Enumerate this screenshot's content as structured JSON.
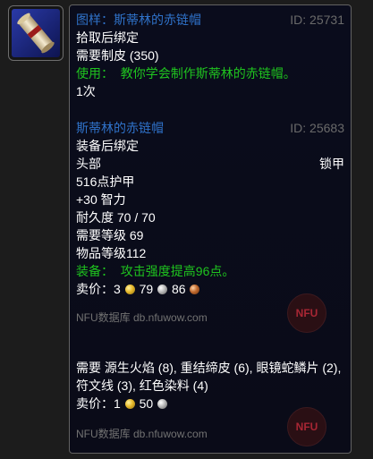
{
  "item_icon": "pattern-scroll-icon",
  "pattern": {
    "name": "图样：斯蒂林的赤链帽",
    "id": "ID: 25731",
    "bind": "拾取后绑定",
    "requires_skill": "需要制皮 (350)",
    "use_label": "使用：",
    "use_text": "教你学会制作斯蒂林的赤链帽。",
    "charges": "1次"
  },
  "crafted": {
    "name": "斯蒂林的赤链帽",
    "id": "ID: 25683",
    "bind": "装备后绑定",
    "slot": "头部",
    "armor_type": "锁甲",
    "armor": "516点护甲",
    "stat": "+30 智力",
    "durability": "耐久度 70 / 70",
    "req_level": "需要等级 69",
    "item_level": "物品等级112",
    "equip_label": "装备：",
    "equip_text": "攻击强度提高96点。",
    "sell_label": "卖价：",
    "sell_gold": "3",
    "sell_silver": "79",
    "sell_copper": "86"
  },
  "watermark_1": "NFU数据库 db.nfuwow.com",
  "reagents": {
    "text": "需要 源生火焰 (8), 重结缔皮 (6), 眼镜蛇鳞片 (2), 符文线 (3), 红色染料 (4)",
    "sell_label": "卖价：",
    "sell_gold": "1",
    "sell_silver": "50"
  },
  "watermark_2": "NFU数据库 db.nfuwow.com",
  "logo_text": "NFU",
  "colors": {
    "link_blue": "#2f72c9",
    "id_gray": "#6a6a6a",
    "green": "#1fc41f",
    "background": "#0a0c1c"
  }
}
